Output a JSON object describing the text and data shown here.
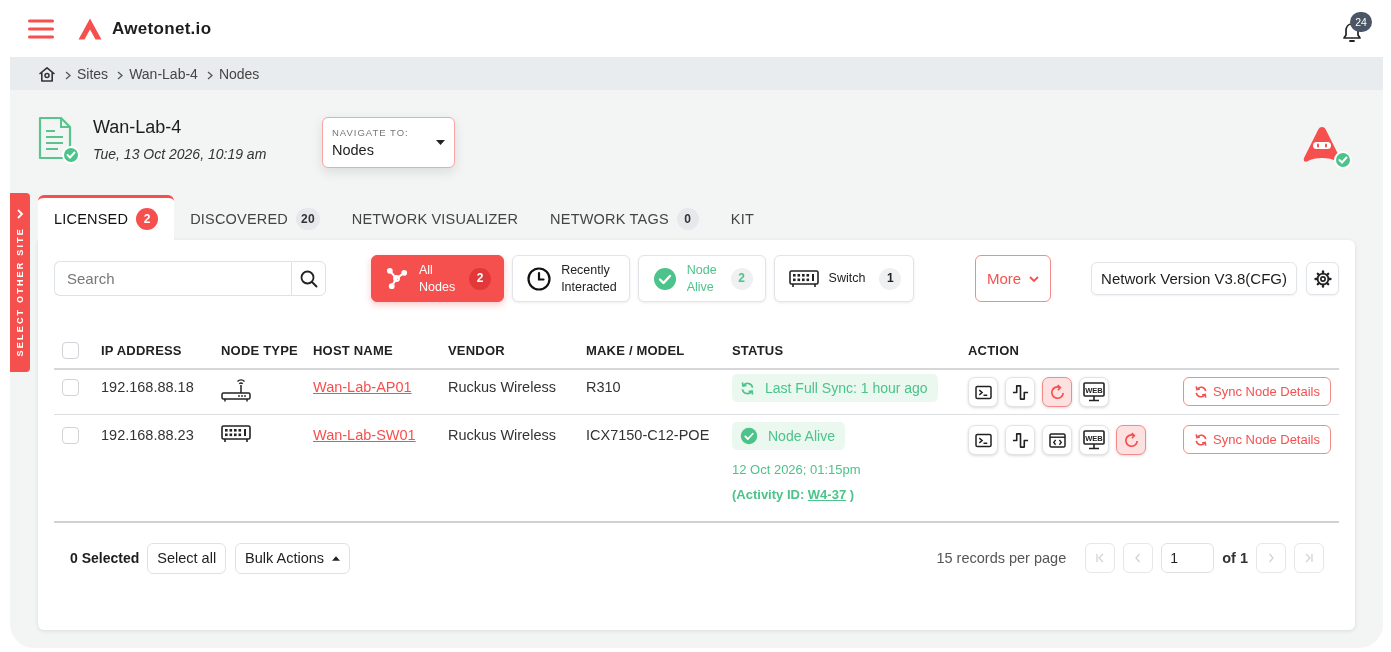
{
  "header": {
    "brand": "Awetonet.io",
    "notification_count": "24"
  },
  "breadcrumb": [
    "Sites",
    "Wan-Lab-4",
    "Nodes"
  ],
  "site": {
    "name": "Wan-Lab-4",
    "timestamp": "Tue, 13 Oct 2026, 10:19 am"
  },
  "navigate": {
    "label": "NAVIGATE TO:",
    "value": "Nodes"
  },
  "side_tab": {
    "label": "SELECT OTHER SITE"
  },
  "tabs": [
    {
      "label": "LICENSED",
      "count": "2",
      "selected": true
    },
    {
      "label": "DISCOVERED",
      "count": "20",
      "selected": false
    },
    {
      "label": "NETWORK VISUALIZER",
      "selected": false
    },
    {
      "label": "NETWORK TAGS",
      "count": "0",
      "selected": false
    },
    {
      "label": "KIT",
      "selected": false
    }
  ],
  "toolbar": {
    "search": {
      "placeholder": "Search"
    },
    "filters": [
      {
        "kind": "all",
        "label": "All Nodes",
        "count": "2",
        "selected": true
      },
      {
        "kind": "recent",
        "label": "Recently Interacted",
        "selected": false
      },
      {
        "kind": "alive",
        "label": "Node Alive",
        "count": "2",
        "selected": false
      },
      {
        "kind": "switch",
        "label": "Switch",
        "count": "1",
        "selected": false
      }
    ],
    "more": "More",
    "network_version": "Network Version V3.8(CFG)"
  },
  "table": {
    "all_checked": false,
    "columns": [
      "IP ADDRESS",
      "NODE TYPE",
      "HOST NAME",
      "VENDOR",
      "MAKE / MODEL",
      "STATUS",
      "ACTION"
    ],
    "rows": [
      {
        "kind": "access_point",
        "checked": false,
        "ip": "192.168.88.18",
        "host": "Wan-Lab-AP01",
        "vendor": "Ruckus Wireless",
        "model": "R310",
        "status": {
          "kind": "sync",
          "text": "Last Full Sync: 1 hour ago"
        },
        "actions": [
          {
            "kind": "terminal"
          },
          {
            "kind": "pulse"
          },
          {
            "kind": "reboot"
          },
          {
            "kind": "web",
            "label": "WEB"
          }
        ],
        "sync_button": "Sync Node Details"
      },
      {
        "kind": "switch",
        "checked": false,
        "ip": "192.168.88.23",
        "host": "Wan-Lab-SW01",
        "vendor": "Ruckus Wireless",
        "model": "ICX7150-C12-POE",
        "status": {
          "kind": "alive",
          "text": "Node Alive",
          "time": "12 Oct 2026; 01:15pm",
          "activity": {
            "prefix": "(Activity ID:",
            "id": "W4-37",
            "suffix": ")"
          }
        },
        "actions": [
          {
            "kind": "terminal"
          },
          {
            "kind": "pulse"
          },
          {
            "kind": "code"
          },
          {
            "kind": "web",
            "label": "WEB"
          },
          {
            "kind": "reboot"
          }
        ],
        "sync_button": "Sync Node Details"
      }
    ]
  },
  "footer": {
    "selected": "0 Selected",
    "select_all": "Select all",
    "bulk_actions": "Bulk Actions",
    "per_page": "15 records per page",
    "pager": {
      "page": "1",
      "total": "of 1",
      "buttons": [
        {
          "kind": "first",
          "disabled": true
        },
        {
          "kind": "prev",
          "disabled": true
        },
        {
          "kind": "next",
          "disabled": true
        },
        {
          "kind": "last",
          "disabled": true
        }
      ]
    }
  }
}
